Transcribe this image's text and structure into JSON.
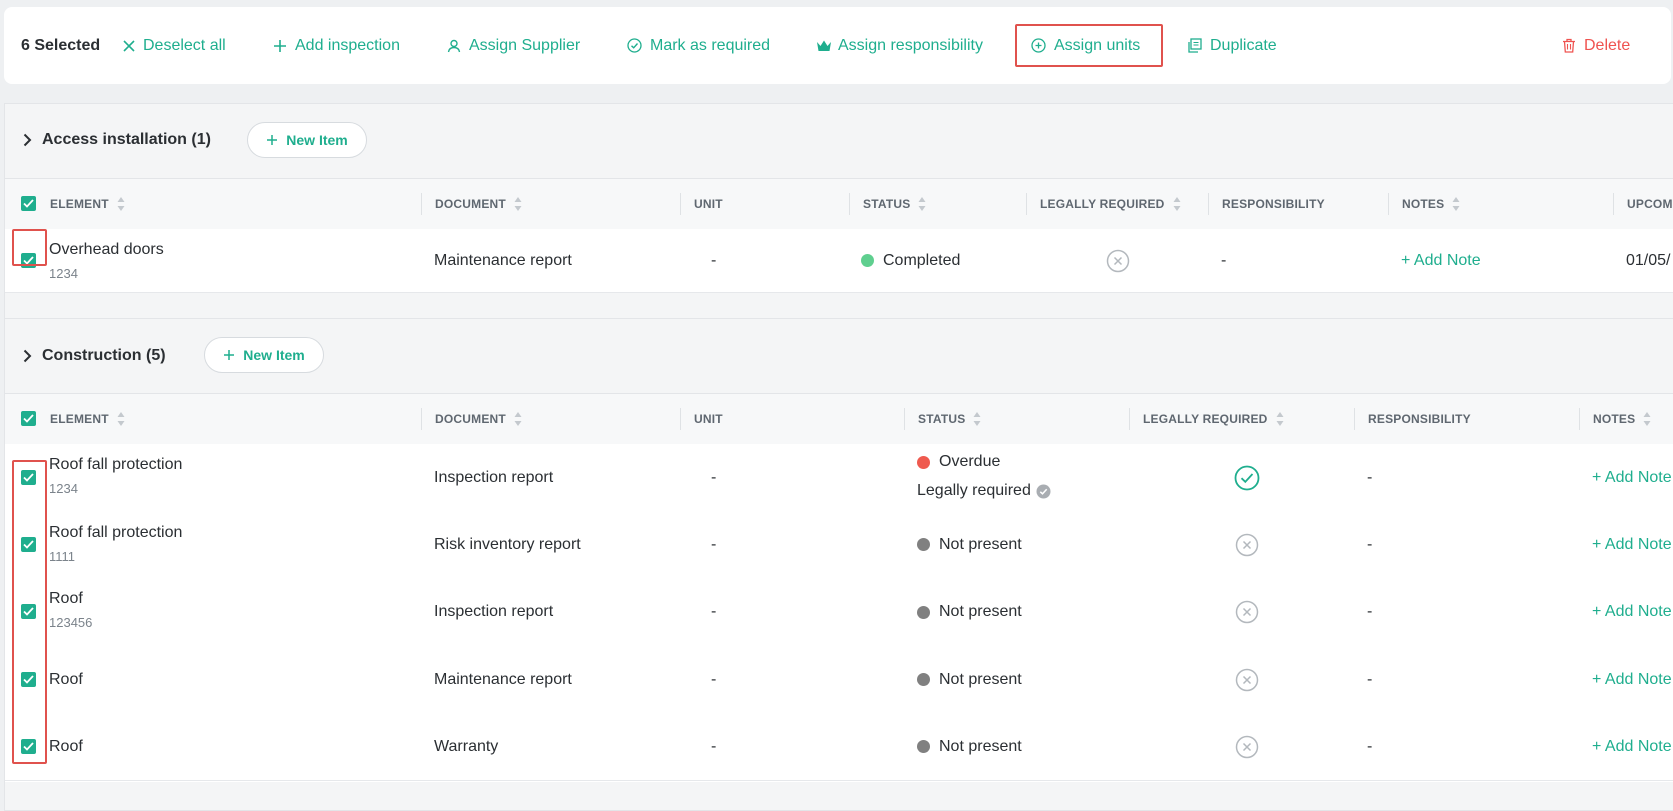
{
  "colors": {
    "accent": "#1fae8e",
    "danger": "#ef5350",
    "highlight": "#e0524d",
    "status_completed": "#5fcf8f",
    "status_overdue": "#ef5a4f",
    "status_not_present": "#808080"
  },
  "toolbar": {
    "selected_count": "6 Selected",
    "deselect_all": "Deselect all",
    "add_inspection": "Add inspection",
    "assign_supplier": "Assign Supplier",
    "mark_as_required": "Mark as required",
    "assign_responsibility": "Assign responsibility",
    "assign_units": "Assign units",
    "duplicate": "Duplicate",
    "delete": "Delete"
  },
  "sections": [
    {
      "title": "Access installation (1)",
      "new_item": "New Item",
      "columns": [
        "ELEMENT",
        "DOCUMENT",
        "UNIT",
        "STATUS",
        "LEGALLY REQUIRED",
        "RESPONSIBILITY",
        "NOTES",
        "UPCOM"
      ],
      "rows": [
        {
          "element": "Overhead doors",
          "code": "1234",
          "document": "Maintenance report",
          "unit": "-",
          "status": "Completed",
          "legally_required": false,
          "responsibility": "-",
          "notes": "+ Add Note",
          "upcoming": "01/05/"
        }
      ]
    },
    {
      "title": "Construction (5)",
      "new_item": "New Item",
      "columns": [
        "ELEMENT",
        "DOCUMENT",
        "UNIT",
        "STATUS",
        "LEGALLY REQUIRED",
        "RESPONSIBILITY",
        "NOTES"
      ],
      "rows": [
        {
          "element": "Roof fall protection",
          "code": "1234",
          "document": "Inspection report",
          "unit": "-",
          "status": "Overdue",
          "status_note": "Legally required",
          "legally_required": true,
          "responsibility": "-",
          "notes": "+ Add Note"
        },
        {
          "element": "Roof fall protection",
          "code": "1111",
          "document": "Risk inventory report",
          "unit": "-",
          "status": "Not present",
          "legally_required": false,
          "responsibility": "-",
          "notes": "+ Add Note"
        },
        {
          "element": "Roof",
          "code": "123456",
          "document": "Inspection report",
          "unit": "-",
          "status": "Not present",
          "legally_required": false,
          "responsibility": "-",
          "notes": "+ Add Note"
        },
        {
          "element": "Roof",
          "code": "",
          "document": "Maintenance report",
          "unit": "-",
          "status": "Not present",
          "legally_required": false,
          "responsibility": "-",
          "notes": "+ Add Note"
        },
        {
          "element": "Roof",
          "code": "",
          "document": "Warranty",
          "unit": "-",
          "status": "Not present",
          "legally_required": false,
          "responsibility": "-",
          "notes": "+ Add Note"
        }
      ]
    }
  ]
}
